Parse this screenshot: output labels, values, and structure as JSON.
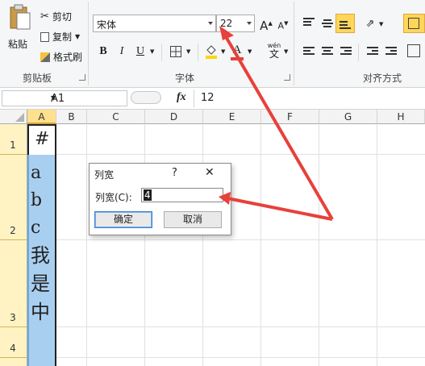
{
  "ribbon": {
    "clipboard": {
      "paste_label": "粘贴",
      "cut_label": "剪切",
      "copy_label": "复制",
      "format_painter_label": "格式刷",
      "group_label": "剪贴板"
    },
    "font": {
      "font_name": "宋体",
      "font_size": "22",
      "bold": "B",
      "italic": "I",
      "underline": "U",
      "font_color_glyph": "A",
      "pinyin_glyph": "wén",
      "pinyin_char": "文",
      "grow_glyph": "A",
      "shrink_glyph": "A",
      "group_label": "字体"
    },
    "alignment": {
      "group_label": "对齐方式"
    }
  },
  "formula_bar": {
    "name_box": "A1",
    "fx": "fx",
    "content": "12"
  },
  "sheet": {
    "columns": [
      "A",
      "B",
      "C",
      "D",
      "E",
      "F",
      "G",
      "H"
    ],
    "rows": [
      "1",
      "2",
      "3",
      "4"
    ],
    "cells": {
      "a1": "#",
      "a2_lines": [
        "a",
        "b",
        "c"
      ],
      "a3_lines": [
        "我",
        "是",
        "中"
      ]
    }
  },
  "dialog": {
    "title": "列宽",
    "help": "?",
    "close": "✕",
    "field_label": "列宽(C):",
    "field_value": "4",
    "ok_label": "确定",
    "cancel_label": "取消"
  },
  "colors": {
    "annotation_arrow": "#e8403a",
    "selected_column": "#a9cff0",
    "selected_row_header": "#fff3c4",
    "accent_highlight": "#ffd55a"
  }
}
